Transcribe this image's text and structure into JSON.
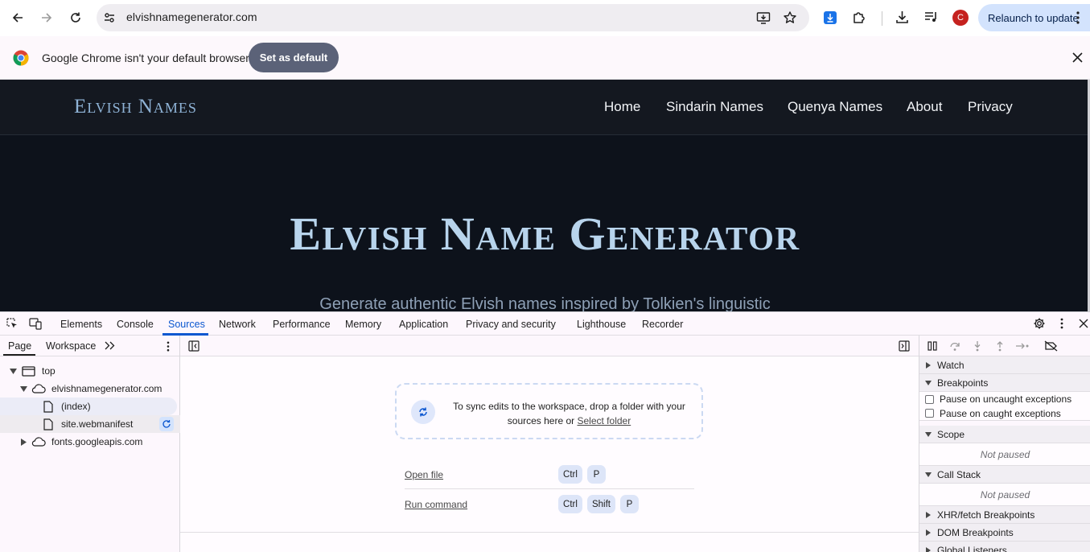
{
  "browser": {
    "url": "elvishnamegenerator.com",
    "relaunch_label": "Relaunch to update",
    "avatar_letter": "C"
  },
  "infobar": {
    "message": "Google Chrome isn't your default browser",
    "button_label": "Set as default"
  },
  "site": {
    "logo": "Elvish Names",
    "nav": [
      "Home",
      "Sindarin Names",
      "Quenya Names",
      "About",
      "Privacy"
    ],
    "hero_title": "Elvish Name Generator",
    "hero_subtitle": "Generate authentic Elvish names inspired by Tolkien's linguistic"
  },
  "devtools": {
    "tabs": [
      "Elements",
      "Console",
      "Sources",
      "Network",
      "Performance",
      "Memory",
      "Application",
      "Privacy and security",
      "Lighthouse",
      "Recorder"
    ],
    "active_tab": "Sources",
    "navigator": {
      "tabs": [
        "Page",
        "Workspace"
      ],
      "tree": {
        "top": "top",
        "domain": "elvishnamegenerator.com",
        "files": [
          "(index)",
          "site.webmanifest"
        ],
        "other_domain": "fonts.googleapis.com"
      }
    },
    "editor": {
      "drop_text": "To sync edits to the workspace, drop a folder with your sources here or",
      "select_folder": "Select folder",
      "shortcuts": [
        {
          "label": "Open file",
          "keys": [
            "Ctrl",
            "P"
          ]
        },
        {
          "label": "Run command",
          "keys": [
            "Ctrl",
            "Shift",
            "P"
          ]
        }
      ]
    },
    "debugger": {
      "watch": "Watch",
      "breakpoints": "Breakpoints",
      "pause_uncaught": "Pause on uncaught exceptions",
      "pause_caught": "Pause on caught exceptions",
      "scope": "Scope",
      "not_paused": "Not paused",
      "call_stack": "Call Stack",
      "xhr": "XHR/fetch Breakpoints",
      "dom": "DOM Breakpoints",
      "global": "Global Listeners"
    }
  },
  "colors": {
    "accent": "#0b57d0",
    "site_bg": "#0d121b",
    "logo": "#8fb3d6",
    "hero": "#b8d4ec"
  }
}
